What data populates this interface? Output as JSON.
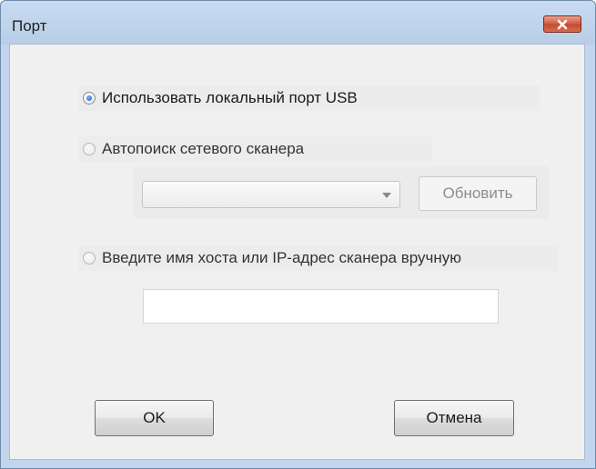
{
  "window": {
    "title": "Порт"
  },
  "options": {
    "usb_label": "Использовать локальный порт USB",
    "usb_checked": true,
    "auto_label": "Автопоиск сетевого сканера",
    "auto_checked": false,
    "manual_label": "Введите имя хоста или IP-адрес сканера вручную",
    "manual_checked": false
  },
  "scanner_select": {
    "value": "",
    "refresh_label": "Обновить"
  },
  "host_input": {
    "value": ""
  },
  "buttons": {
    "ok_label": "OK",
    "cancel_label": "Отмена"
  },
  "colors": {
    "close_button": "#c44a2f",
    "titlebar": "#c2d5ec",
    "client_bg": "#f0f0f0",
    "radio_selected": "#1f5ec2"
  },
  "icons": {
    "close": "close-icon",
    "dropdown": "chevron-down-icon"
  }
}
